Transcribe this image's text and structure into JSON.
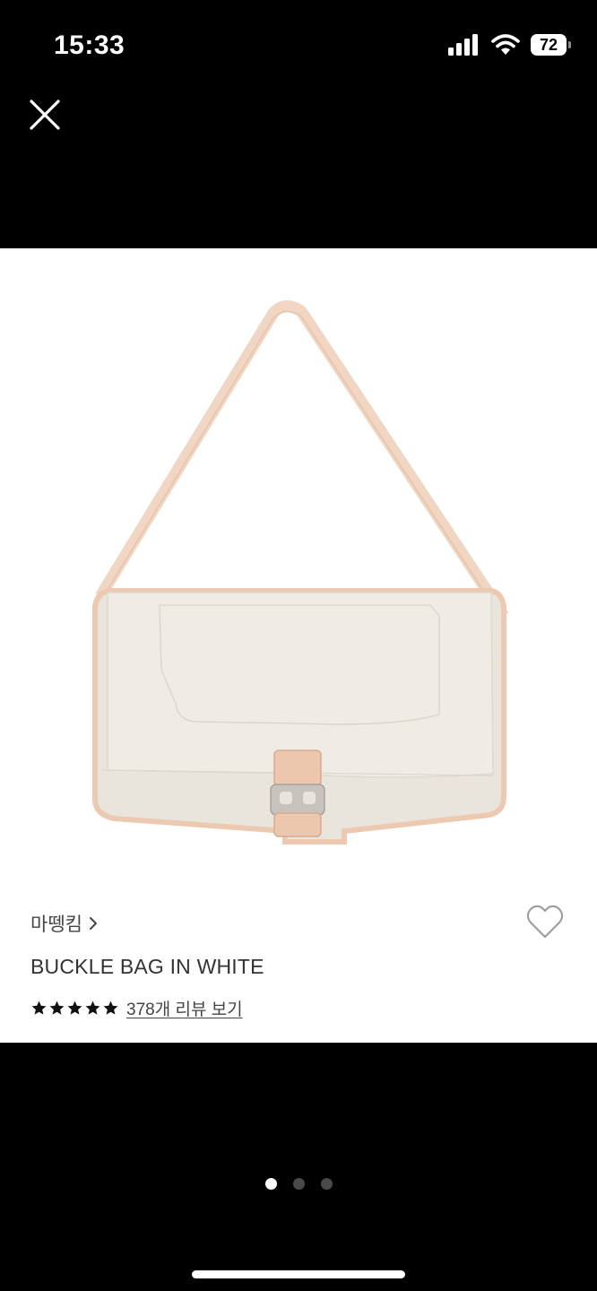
{
  "status_bar": {
    "time": "15:33",
    "battery_level": "72",
    "signal_icon": "signal-bars-icon",
    "wifi_icon": "wifi-icon"
  },
  "toolbar": {
    "close_icon": "close-icon"
  },
  "product": {
    "brand": "마뗑킴",
    "brand_chevron": "chevron-right-icon",
    "name": "BUCKLE BAG IN WHITE",
    "rating": 5,
    "rating_max": 5,
    "review_link": "378개 리뷰 보기",
    "wishlist_icon": "heart-outline-icon",
    "image_description_icon": "product-photo"
  },
  "pager": {
    "count": 3,
    "active_index": 0
  },
  "colors": {
    "background": "#000000",
    "card": "#ffffff",
    "text": "#333333",
    "star": "#111111"
  }
}
